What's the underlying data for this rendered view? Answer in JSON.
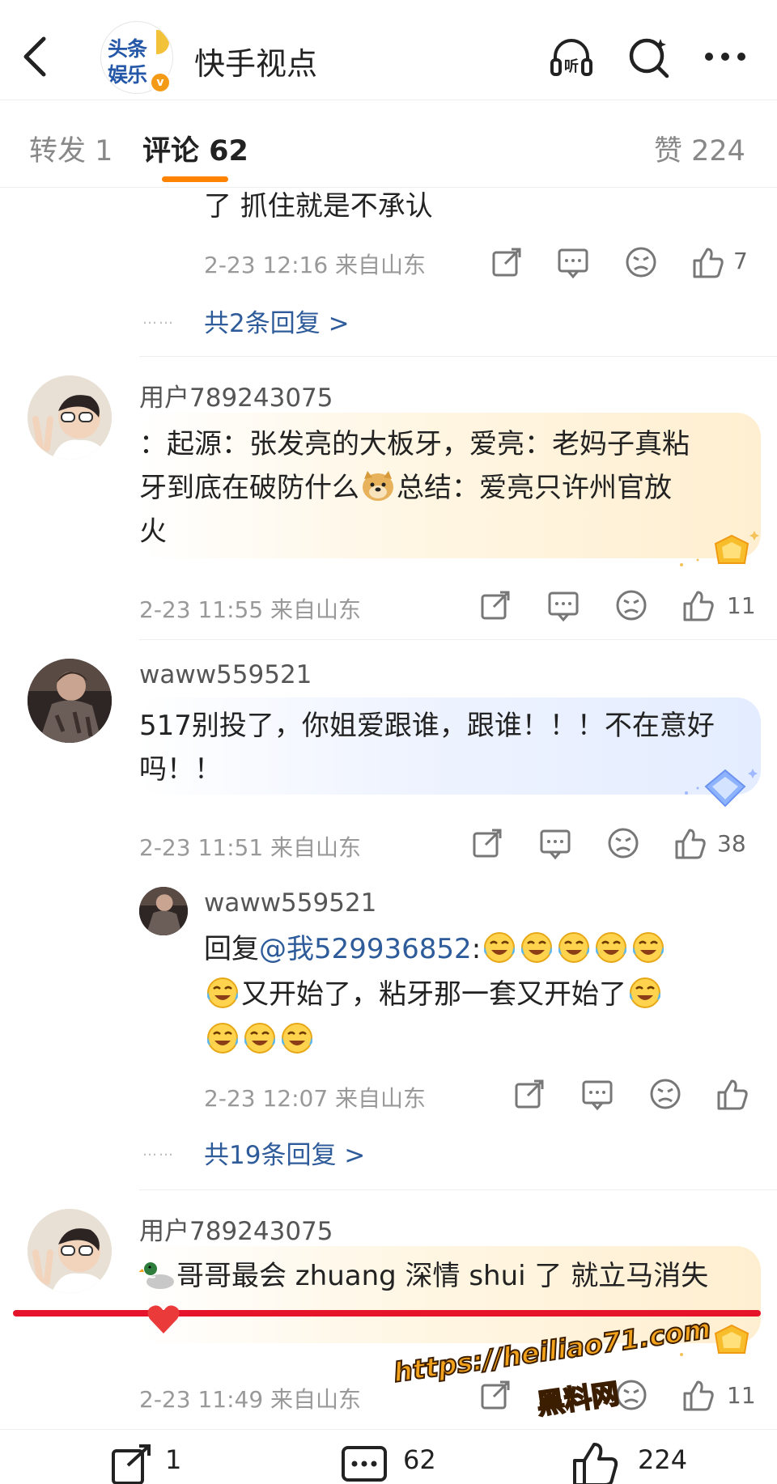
{
  "header": {
    "back_label": "<",
    "logo_line1": "头条",
    "logo_line2": "娱乐",
    "verified_badge": "v",
    "title": "快手视点",
    "listen_label": "听"
  },
  "tabs": {
    "repost": "转发 1",
    "comments": "评论 62",
    "likes": "赞 224"
  },
  "comments": [
    {
      "text_lines": [
        "了 抓住就是不承认"
      ],
      "meta": "2-23 12:16 来自山东",
      "like_count": "7",
      "more_dots": "……",
      "more_replies": "共2条回复 >"
    },
    {
      "user": "用户789243075",
      "text_lines": [
        "：起源：张发亮的大板牙，爱亮：老妈子真粘",
        "牙到底在破防什么",
        "总结：爱亮只许州官放",
        "火"
      ],
      "meta": "2-23 11:55 来自山东",
      "like_count": "11"
    },
    {
      "user": "waww559521",
      "text_lines": [
        "517别投了，你姐爱跟谁，跟谁！！！不在意好",
        "吗！！"
      ],
      "meta": "2-23 11:51 来自山东",
      "like_count": "38",
      "reply": {
        "user": "waww559521",
        "prefix": "回复",
        "mention": "@我529936852",
        "colon": ":",
        "text_line2": "又开始了，粘牙那一套又开始了",
        "meta": "2-23 12:07 来自山东"
      },
      "more_dots": "……",
      "more_replies": "共19条回复 >"
    },
    {
      "user": "用户789243075",
      "text_lines": [
        "哥哥最会 zhuang 深情 shui 了 就立马消失"
      ],
      "meta": "2-23 11:49 来自山东",
      "like_count": "11"
    }
  ],
  "watermark": {
    "url": "https://heiliao71.com",
    "name": "黑料网"
  },
  "footer": {
    "repost_count": "1",
    "comment_count": "62",
    "like_count": "224"
  },
  "colors": {
    "accent": "#ff8200",
    "link": "#2e5b9a",
    "red_line": "#e5142b"
  }
}
